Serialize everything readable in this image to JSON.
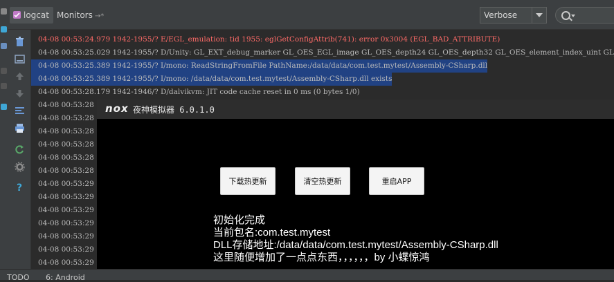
{
  "tabs": [
    {
      "label": "logcat",
      "active": true
    },
    {
      "label": "Monitors",
      "pin": "→*"
    }
  ],
  "log_level": {
    "selected": "Verbose"
  },
  "log_lines": [
    {
      "text": "04-08 00:53:24.979 1942-1955/? E/EGL_emulation: tid 1955: eglGetConfigAttrib(741): error 0x3004 (EGL_BAD_ATTRIBUTE)",
      "level": "error"
    },
    {
      "text": "04-08 00:53:25.029 1942-1955/? D/Unity: GL_EXT_debug_marker GL_OES_EGL_image GL_OES_depth24 GL_OES_depth32 GL_OES_element_index_uint GL_OES",
      "level": "debug"
    },
    {
      "text": "04-08 00:53:25.389 1942-1955/? I/mono: ReadStringFromFile PathName:/data/data/com.test.mytest/Assembly-CSharp.dll",
      "level": "info",
      "selected": true
    },
    {
      "text": "04-08 00:53:25.389 1942-1955/? I/mono: /data/data/com.test.mytest/Assembly-CSharp.dll exists",
      "level": "info",
      "selected": true
    },
    {
      "text": "04-08 00:53:28.179 1942-1946/? D/dalvikvm: JIT code cache reset in 0 ms (0 bytes 1/0)",
      "level": "debug"
    },
    {
      "text": "04-08 00:53:28",
      "level": "debug"
    },
    {
      "text": "04-08 00:53:28",
      "level": "debug"
    },
    {
      "text": "04-08 00:53:28",
      "level": "debug"
    },
    {
      "text": "04-08 00:53:28",
      "level": "debug"
    },
    {
      "text": "04-08 00:53:28",
      "level": "debug"
    },
    {
      "text": "04-08 00:53:28",
      "level": "debug"
    },
    {
      "text": "04-08 00:53:29",
      "level": "debug"
    },
    {
      "text": "04-08 00:53:29",
      "level": "debug"
    },
    {
      "text": "04-08 00:53:29",
      "level": "debug"
    },
    {
      "text": "04-08 00:53:29",
      "level": "debug"
    },
    {
      "text": "04-08 00:53:29",
      "level": "debug"
    },
    {
      "text": "04-08 00:53:29",
      "level": "debug"
    },
    {
      "text": "04-08 00:53:29",
      "level": "debug"
    }
  ],
  "emulator": {
    "logo": "nox",
    "title": "夜神模拟器 6.0.1.0",
    "buttons": [
      "下载热更新",
      "清空热更新",
      "重启APP"
    ],
    "info_lines": [
      "初始化完成",
      "当前包名:com.test.mytest",
      "DLL存储地址:/data/data/com.test.mytest/Assembly-CSharp.dll",
      "这里随便增加了一点点东西，，，，，，by 小蝶惊鸿"
    ]
  },
  "bottom_tabs": [
    "TODO",
    "6: Android"
  ],
  "colors": {
    "background": "#2b2b2b",
    "panel": "#3c3f41",
    "error_text": "#ff6b68",
    "selection": "#214283"
  }
}
